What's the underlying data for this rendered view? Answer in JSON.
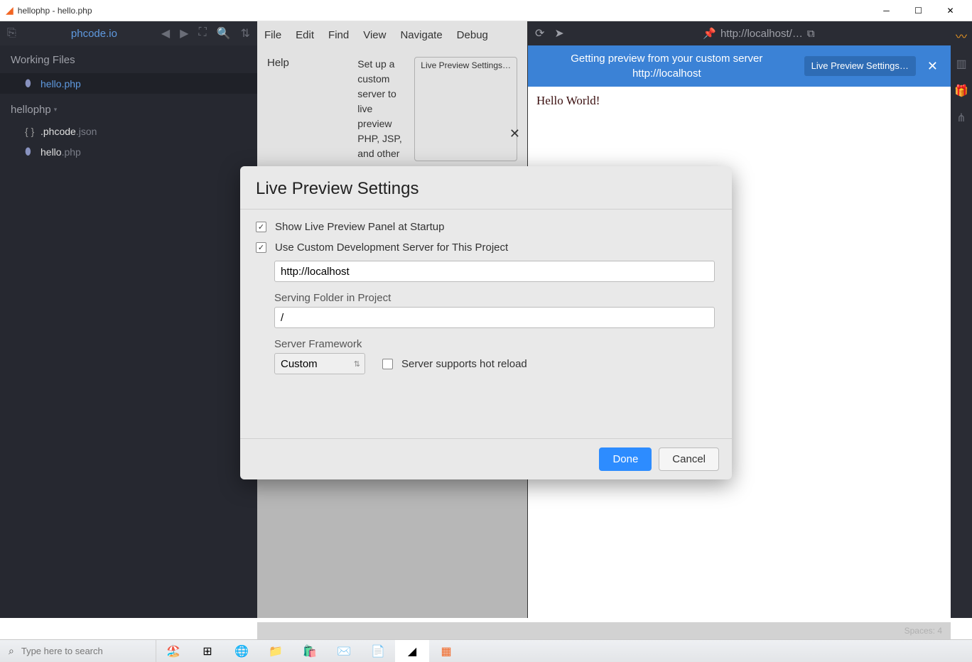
{
  "window": {
    "title": "hellophp - hello.php"
  },
  "sidebar": {
    "project_link": "phcode.io",
    "working_files_label": "Working Files",
    "active_file": "hello.php",
    "project_name": "hellophp",
    "files": [
      {
        "name_bold": ".phcode",
        "name_ext": ".json",
        "icon": "json"
      },
      {
        "name_bold": "hello",
        "name_ext": ".php",
        "icon": "php"
      }
    ]
  },
  "menubar": {
    "items": [
      "File",
      "Edit",
      "Find",
      "View",
      "Navigate",
      "Debug"
    ]
  },
  "help_panel": {
    "help_label": "Help",
    "text": "Set up a custom server to live preview PHP, JSP, and other",
    "button": "Live Preview Settings…"
  },
  "preview": {
    "url": "http://localhost/…",
    "banner_text_line1": "Getting preview from your custom server",
    "banner_text_line2": "http://localhost",
    "banner_button": "Live Preview Settings…",
    "body": "Hello World!"
  },
  "modal": {
    "title": "Live Preview Settings",
    "check1": "Show Live Preview Panel at Startup",
    "check2": "Use Custom Development Server for This Project",
    "url_value": "http://localhost",
    "serving_folder_label": "Serving Folder in Project",
    "serving_folder_value": "/",
    "framework_label": "Server Framework",
    "framework_value": "Custom",
    "hot_reload_label": "Server supports hot reload",
    "done": "Done",
    "cancel": "Cancel"
  },
  "status": {
    "spaces": "Spaces: 4"
  },
  "taskbar": {
    "search_placeholder": "Type here to search"
  }
}
